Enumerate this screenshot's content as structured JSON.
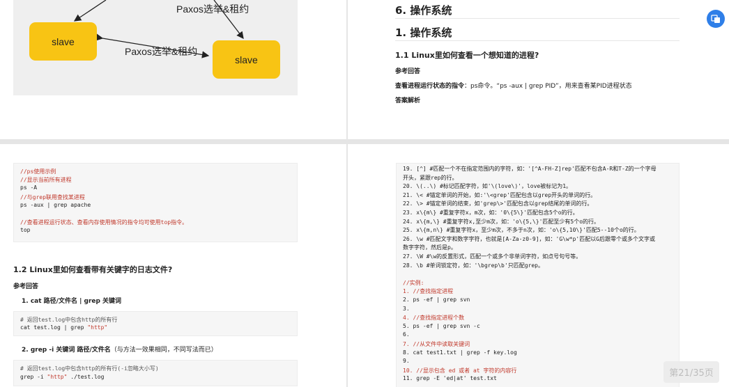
{
  "diagram": {
    "node_left": "slave",
    "node_right": "slave",
    "label_top": "Paxos选举&租约",
    "label_mid": "Paxos选举&租约"
  },
  "page2": {
    "chapter": "6. 操作系统",
    "section": "1. 操作系统",
    "q1": "1.1 Linux里如何查看一个想知道的进程?",
    "ref": "参考回答",
    "answer_bold": "查看进程运行状态的指令",
    "answer_rest": "：ps命令。“ps -aux | grep PID”，用来查看某PID进程状态",
    "analysis": "答案解析"
  },
  "page3": {
    "code1": [
      {
        "t": "//ps使用示例",
        "c": true
      },
      {
        "t": "//显示当前所有进程",
        "c": true
      },
      {
        "t": "ps -A",
        "c": false
      },
      {
        "t": "//与grep联用查找某进程",
        "c": true
      },
      {
        "t": "ps -aux | grep apache",
        "c": false
      },
      {
        "t": "",
        "c": false
      },
      {
        "t": "//查看进程运行状态、查看内存使用情况的指令均可使用top指令。",
        "c": true
      },
      {
        "t": "top",
        "c": false
      }
    ],
    "q2": "1.2 Linux里如何查看带有关键字的日志文件?",
    "ref": "参考回答",
    "item1": "1. cat 路径/文件名 | grep 关键词",
    "code2_comment": "# 返回test.log中包含http的所有行",
    "code2_cmd": "cat test.log | grep ",
    "code2_str": "\"http\"",
    "item2_bold": "2. grep -i 关键词 路径/文件名",
    "item2_rest": "（与方法一效果相同，不同写法而已）",
    "code3_comment": "# 返回test.log中包含http的所有行(-i忽略大小写)",
    "code3_cmd1": "grep -i ",
    "code3_str": "\"http\"",
    "code3_cmd2": " ./test.log"
  },
  "page4": {
    "lines": [
      "19. [^]      #匹配一个不在指定范围内的字符，如：'[^A-FH-Z]rep'匹配不包含A-R和T-Z的一个字母",
      "开头，紧跟rep的行。",
      "20. \\(..\\)    #标记匹配字符，如'\\(love\\)'，love被标记为1。",
      "21. \\<       #锚定单词的开始，如:'\\<grep'匹配包含以grep开头的单词的行。",
      "22. \\>       #锚定单词的结束，如'grep\\>'匹配包含以grep结尾的单词的行。",
      "23. x\\{m\\}    #重复字符x，m次，如：'0\\{5\\}'匹配包含5个o的行。",
      "24. x\\{m,\\}   #重复字符x,至少m次，如：'o\\{5,\\}'匹配至少有5个o的行。",
      "25. x\\{m,n\\}  #重复字符x，至少m次，不多于n次，如：'o\\{5,10\\}'匹配5--10个o的行。",
      "26. \\w       #匹配文字和数字字符，也就是[A-Za-z0-9]，如：'G\\w*p'匹配以G后跟零个或多个文字或",
      "数字字符，然后是p。",
      "27. \\W       #\\w的反置形式，匹配一个或多个非单词字符，如点号句号等。",
      "28. \\b       #单词锁定符，如：'\\bgrep\\b'只匹配grep。",
      "",
      "//实例:",
      "1.  //查找指定进程",
      "2.  ps -ef | grep svn",
      "3.",
      "4.  //查找指定进程个数",
      "5.  ps -ef | grep svn -c",
      "6.",
      "7.  //从文件中读取关键词",
      "8.  cat test1.txt | grep -f key.log",
      "9.",
      "10. //显示包含 ed 或者 at 字符的内容行",
      "11. grep -E 'ed|at' test.txt"
    ],
    "comment_lines": [
      13,
      14,
      17,
      20,
      23
    ]
  },
  "watermark": "第21/35页"
}
